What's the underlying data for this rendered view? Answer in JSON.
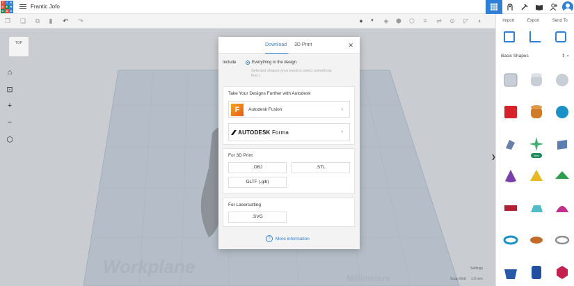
{
  "app": {
    "design_title": "Frantic Jofo",
    "logo_letters": [
      "T",
      "I",
      "N",
      "K",
      "E",
      "R",
      "C",
      "A",
      "D"
    ],
    "logo_colors": [
      "#e84d3c",
      "#2f7fd6",
      "#2f7fd6",
      "#e84d3c",
      "#1a8a5a",
      "#2f7fd6",
      "#1a8a5a",
      "#e84d3c",
      "#2f7fd6"
    ]
  },
  "right_panel": {
    "tabs": [
      "Import",
      "Export",
      "Send To"
    ],
    "library_select": "Basic Shapes",
    "new_badge": "New",
    "collapse_chevron": "❯"
  },
  "canvas": {
    "viewcube_label": "TOP",
    "workplane_text": "Workplane",
    "units_text": "Millimeters",
    "settings_label": "Settings",
    "snap_grid_label": "Snap Grid",
    "snap_grid_value": "1.0 mm"
  },
  "modal": {
    "tabs": [
      "Download",
      "3D Print"
    ],
    "active_tab": "Download",
    "close_glyph": "✕",
    "include_label": "Include",
    "option_everything": "Everything in the design.",
    "option_selected": "Selected shapes (you need to select something first.)",
    "further_title": "Take Your Designs Further with Autodesk",
    "fusion_icon_letter": "F",
    "fusion_label": "Autodesk Fusion",
    "forma_brand": "AUTODESK",
    "forma_product": "Forma",
    "print_title": "For 3D Print",
    "print_formats": [
      ".OBJ",
      ".STL",
      "GLTF (.glb)"
    ],
    "laser_title": "For Lasercutting",
    "laser_formats": [
      ".SVG"
    ],
    "more_info": "More information",
    "chevron": "›",
    "help_glyph": "?"
  },
  "colors": {
    "accent": "#2f7fd6",
    "fusion_orange": "#f28a1c"
  }
}
